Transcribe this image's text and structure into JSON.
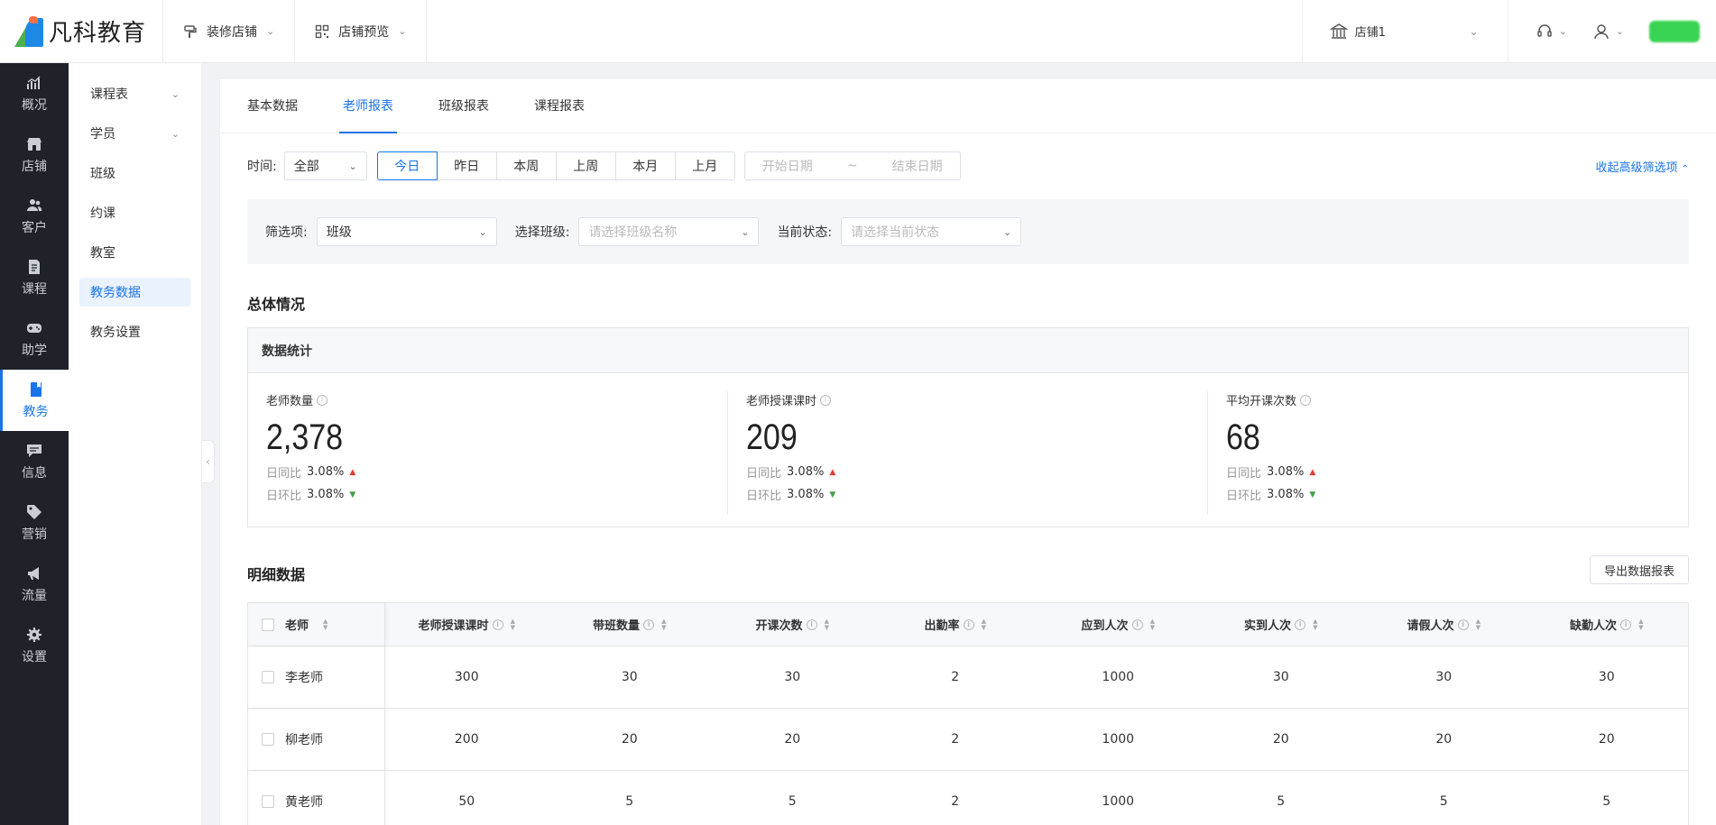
{
  "brand": {
    "name": "凡科教育"
  },
  "topbar": {
    "menus": [
      {
        "label": "装修店铺",
        "icon": "paint-roller-icon"
      },
      {
        "label": "店铺预览",
        "icon": "qr-code-icon"
      }
    ],
    "store": {
      "label": "店铺1"
    }
  },
  "sidenav": [
    {
      "label": "概况",
      "icon": "chart-icon",
      "active": false
    },
    {
      "label": "店铺",
      "icon": "store-icon",
      "active": false
    },
    {
      "label": "客户",
      "icon": "users-icon",
      "active": false
    },
    {
      "label": "课程",
      "icon": "document-icon",
      "active": false
    },
    {
      "label": "助学",
      "icon": "gamepad-icon",
      "active": false
    },
    {
      "label": "教务",
      "icon": "book-icon",
      "active": true
    },
    {
      "label": "信息",
      "icon": "message-icon",
      "active": false
    },
    {
      "label": "营销",
      "icon": "tag-icon",
      "active": false
    },
    {
      "label": "流量",
      "icon": "megaphone-icon",
      "active": false
    },
    {
      "label": "设置",
      "icon": "gear-icon",
      "active": false
    }
  ],
  "subnav": [
    {
      "label": "课程表",
      "expandable": true
    },
    {
      "label": "学员",
      "expandable": true
    },
    {
      "label": "班级"
    },
    {
      "label": "约课"
    },
    {
      "label": "教室"
    },
    {
      "label": "教务数据",
      "active": true
    },
    {
      "label": "教务设置"
    }
  ],
  "tabs": [
    "基本数据",
    "老师报表",
    "班级报表",
    "课程报表"
  ],
  "active_tab": "老师报表",
  "time_filter": {
    "label": "时间:",
    "select_value": "全部",
    "ranges": [
      "今日",
      "昨日",
      "本周",
      "上周",
      "本月",
      "上月"
    ],
    "active_range": "今日",
    "start_placeholder": "开始日期",
    "separator": "~",
    "end_placeholder": "结束日期",
    "advanced_link": "收起高级筛选项"
  },
  "advanced_filter": {
    "filter_label": "筛选项:",
    "filter_value": "班级",
    "class_label": "选择班级:",
    "class_placeholder": "请选择班级名称",
    "status_label": "当前状态:",
    "status_placeholder": "请选择当前状态"
  },
  "overview": {
    "title": "总体情况",
    "box_title": "数据统计",
    "stats": [
      {
        "label": "老师数量",
        "value": "2,378",
        "dod_label": "日同比",
        "dod": "3.08%",
        "dod_dir": "up",
        "wow_label": "日环比",
        "wow": "3.08%",
        "wow_dir": "down"
      },
      {
        "label": "老师授课课时",
        "value": "209",
        "dod_label": "日同比",
        "dod": "3.08%",
        "dod_dir": "up",
        "wow_label": "日环比",
        "wow": "3.08%",
        "wow_dir": "down"
      },
      {
        "label": "平均开课次数",
        "value": "68",
        "dod_label": "日同比",
        "dod": "3.08%",
        "dod_dir": "up",
        "wow_label": "日环比",
        "wow": "3.08%",
        "wow_dir": "down"
      }
    ]
  },
  "detail": {
    "title": "明细数据",
    "export_label": "导出数据报表",
    "columns": [
      "老师",
      "老师授课课时",
      "带班数量",
      "开课次数",
      "出勤率",
      "应到人次",
      "实到人次",
      "请假人次",
      "缺勤人次"
    ],
    "rows": [
      [
        "李老师",
        "300",
        "30",
        "30",
        "2",
        "1000",
        "30",
        "30",
        "30"
      ],
      [
        "柳老师",
        "200",
        "20",
        "20",
        "2",
        "1000",
        "20",
        "20",
        "20"
      ],
      [
        "黄老师",
        "50",
        "5",
        "5",
        "2",
        "1000",
        "5",
        "5",
        "5"
      ]
    ]
  },
  "colors": {
    "accent": "#1a73e8",
    "sidenav_bg": "#1f2329",
    "up": "#e53935",
    "down": "#43a047"
  }
}
